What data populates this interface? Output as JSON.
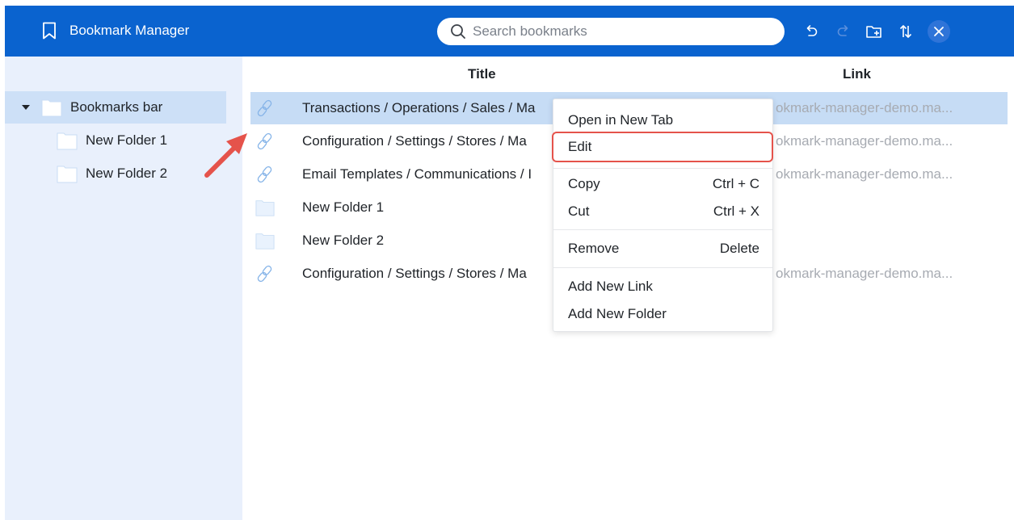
{
  "header": {
    "app_title": "Bookmark Manager",
    "search_placeholder": "Search bookmarks",
    "icons": [
      "bookmark-icon",
      "search-icon",
      "undo-icon",
      "redo-icon",
      "new-folder-icon",
      "sort-icon",
      "close-icon"
    ]
  },
  "sidebar": {
    "root": {
      "label": "Bookmarks bar",
      "expanded": true
    },
    "children": [
      {
        "label": "New Folder 1"
      },
      {
        "label": "New Folder 2"
      }
    ]
  },
  "table": {
    "columns": {
      "title": "Title",
      "link": "Link"
    },
    "rows": [
      {
        "type": "link",
        "title": "Transactions / Operations / Sales / Ma",
        "link": "okmark-manager-demo.ma...",
        "selected": true
      },
      {
        "type": "link",
        "title": "Configuration / Settings / Stores / Ma",
        "link": "okmark-manager-demo.ma..."
      },
      {
        "type": "link",
        "title": "Email Templates / Communications / I",
        "link": "okmark-manager-demo.ma..."
      },
      {
        "type": "folder",
        "title": "New Folder 1",
        "link": ""
      },
      {
        "type": "folder",
        "title": "New Folder 2",
        "link": ""
      },
      {
        "type": "link",
        "title": "Configuration / Settings / Stores / Ma",
        "link": "okmark-manager-demo.ma..."
      }
    ]
  },
  "context_menu": {
    "items": [
      {
        "label": "Open in New Tab",
        "shortcut": ""
      },
      {
        "label": "Edit",
        "shortcut": "",
        "highlighted": true
      },
      {
        "label": "Copy",
        "shortcut": "Ctrl + C"
      },
      {
        "label": "Cut",
        "shortcut": "Ctrl + X"
      },
      {
        "label": "Remove",
        "shortcut": "Delete"
      },
      {
        "label": "Add New Link",
        "shortcut": ""
      },
      {
        "label": "Add New Folder",
        "shortcut": ""
      }
    ]
  },
  "colors": {
    "header": "#0a63cf",
    "sidebar": "#e9f0fc",
    "selection": "#c6dcf5",
    "highlight_border": "#e5534b",
    "arrow": "#e5534b"
  }
}
